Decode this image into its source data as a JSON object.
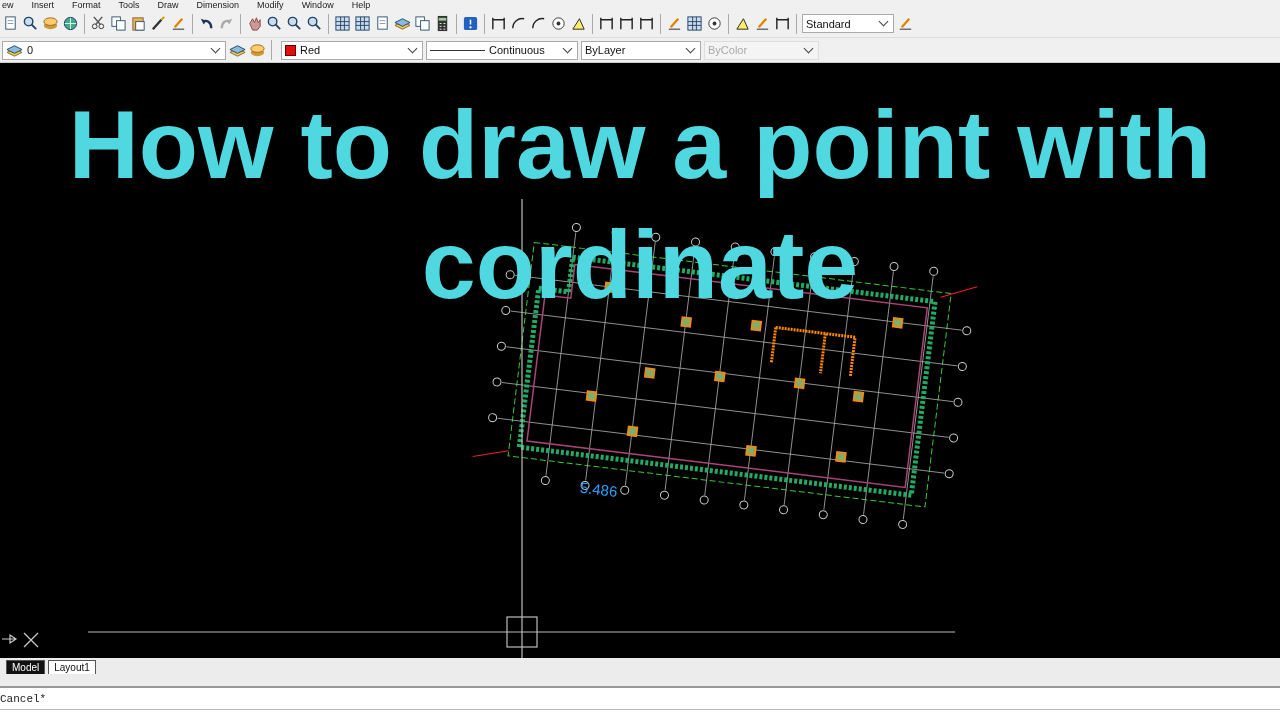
{
  "menu_bar": {
    "items": [
      "ew",
      "Insert",
      "Format",
      "Tools",
      "Draw",
      "Dimension",
      "Modify",
      "Window",
      "Help"
    ]
  },
  "standard_toolbar": {
    "text_style": {
      "value": "Standard"
    }
  },
  "properties_toolbar": {
    "layer": {
      "value": "0"
    },
    "color": {
      "value": "Red"
    },
    "linetype": {
      "value": "Continuous"
    },
    "lineweight": {
      "value": "ByLayer"
    },
    "plot_style": {
      "value": "ByColor",
      "disabled": true
    }
  },
  "overlay_title": "How to draw a point with cordinate",
  "drawing": {
    "dimension_text": "5.486"
  },
  "layout_tabs": [
    {
      "label": "Model",
      "selected": true
    },
    {
      "label": "Layout1",
      "selected": false
    }
  ],
  "command_line": {
    "history": "Cancel*"
  }
}
